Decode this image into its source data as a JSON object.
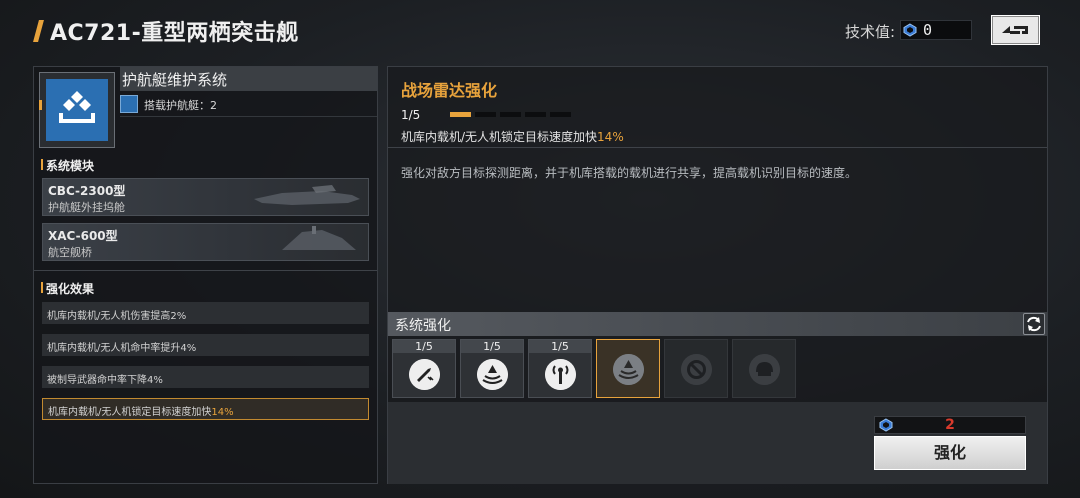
{
  "header": {
    "title": "AC721-重型两栖突击舰",
    "tech_label": "技术值:",
    "tech_value": "0"
  },
  "system": {
    "name": "护航艇维护系统",
    "escort_label": "搭载护航艇：2"
  },
  "modules": {
    "title": "系统模块",
    "items": [
      {
        "name": "CBC-2300型",
        "sub": "护航艇外挂坞舱"
      },
      {
        "name": "XAC-600型",
        "sub": "航空舰桥"
      }
    ]
  },
  "effects": {
    "title": "强化效果",
    "items": [
      {
        "text": "机库内载机/无人机伤害提高2%"
      },
      {
        "text": "机库内载机/无人机命中率提升4%"
      },
      {
        "text": "被制导武器命中率下降4%"
      },
      {
        "text": "机库内载机/无人机锁定目标速度加快",
        "value": "14%"
      }
    ]
  },
  "detail": {
    "title": "战场雷达强化",
    "level": "1/5",
    "level_current": 1,
    "level_max": 5,
    "effect_text": "机库内载机/无人机锁定目标速度加快",
    "effect_value": "14%",
    "description": "强化对敌方目标探测距离，并于机库搭载的载机进行共享，提高载机识别目标的速度。"
  },
  "enhance": {
    "title": "系统强化",
    "slots": [
      {
        "level": "1/5",
        "icon": "missile-icon",
        "state": "normal"
      },
      {
        "level": "1/5",
        "icon": "radar-cone-icon",
        "state": "normal"
      },
      {
        "level": "1/5",
        "icon": "antenna-icon",
        "state": "normal"
      },
      {
        "level": "",
        "icon": "radar-cone-icon",
        "state": "selected"
      },
      {
        "level": "",
        "icon": "repair-icon",
        "state": "locked"
      },
      {
        "level": "",
        "icon": "shield-helmet-icon",
        "state": "locked"
      }
    ],
    "cost": "2",
    "button_label": "强化"
  },
  "colors": {
    "accent": "#e8a33c",
    "cost": "#d83a2c",
    "icon_blue": "#2b6fb2"
  }
}
